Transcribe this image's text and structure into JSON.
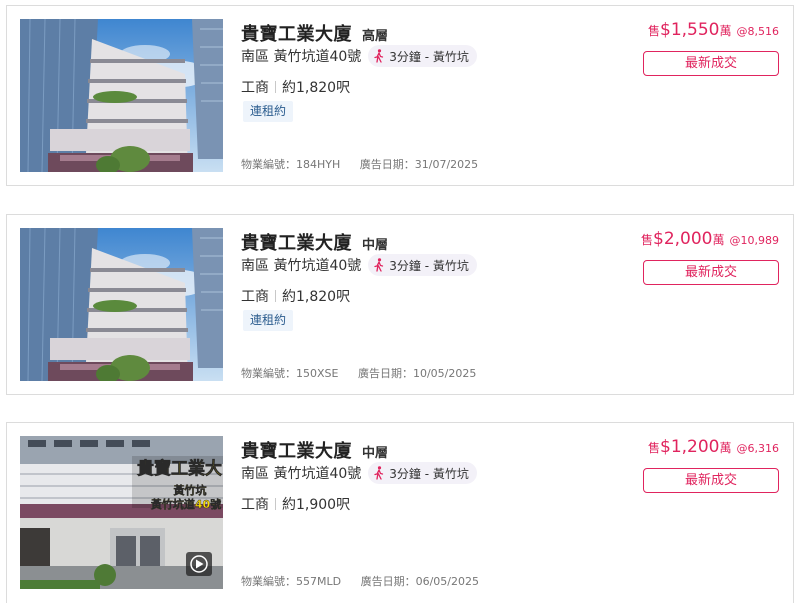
{
  "listings": [
    {
      "building": "貴寶工業大廈",
      "floor": "高層",
      "address": "南區 黃竹坑道40號",
      "walk": "3分鐘 - 黃竹坑",
      "usage": "工商",
      "area": "約1,820呎",
      "tag": "連租約",
      "ref_label": "物業編號：184HYH",
      "date_label": "廣告日期：31/07/2025",
      "sell_prefix": "售",
      "price": "$1,550",
      "price_unit": "萬",
      "unit_price": "@8,516",
      "button": "最新成交",
      "photo": "building-photo"
    },
    {
      "building": "貴寶工業大廈",
      "floor": "中層",
      "address": "南區 黃竹坑道40號",
      "walk": "3分鐘 - 黃竹坑",
      "usage": "工商",
      "area": "約1,820呎",
      "tag": "連租約",
      "ref_label": "物業編號：150XSE",
      "date_label": "廣告日期：10/05/2025",
      "sell_prefix": "售",
      "price": "$2,000",
      "price_unit": "萬",
      "unit_price": "@10,989",
      "button": "最新成交",
      "photo": "building-photo"
    },
    {
      "building": "貴寶工業大廈",
      "floor": "中層",
      "address": "南區 黃竹坑道40號",
      "walk": "3分鐘 - 黃竹坑",
      "usage": "工商",
      "area": "約1,900呎",
      "ref_label": "物業編號：557MLD",
      "date_label": "廣告日期：06/05/2025",
      "sell_prefix": "售",
      "price": "$1,200",
      "price_unit": "萬",
      "unit_price": "@6,316",
      "button": "最新成交",
      "photo": "video-thumbnail",
      "overlay_title": "貴寶工業大",
      "overlay_sub1": "黃竹坑",
      "overlay_sub2": "黃竹坑道40號",
      "play_icon": "play-icon"
    }
  ],
  "colors": {
    "accent": "#e0245e",
    "tag_bg": "#eef4fb",
    "tag_text": "#2c5d8f",
    "overlay_text": "#ffe000"
  }
}
